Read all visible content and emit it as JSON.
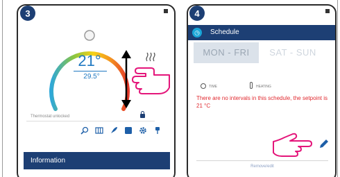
{
  "colors": {
    "accent": "#1d3f74",
    "link": "#1f78c1",
    "warning": "#e0282e",
    "arc_start": "#2fa8d8",
    "arc_end": "#e53a2a"
  },
  "screens": [
    {
      "step": "3",
      "temp_setpoint": "21°",
      "temp_current": "29.5°",
      "thermostat_status": "Thermostat unlocked",
      "heat_icon": "heating-waves-icon",
      "lock_icon": "lock-icon",
      "toolbar_icons": [
        "magnifier-icon",
        "grid-icon",
        "rocket-icon",
        "square-icon",
        "gear-icon",
        "pin-icon"
      ],
      "info_label": "Information"
    },
    {
      "step": "4",
      "header_title": "Schedule",
      "tabs": [
        "MON - FRI",
        "SAT - SUN"
      ],
      "legend_time": "TIME",
      "legend_heating": "HEATING",
      "warning_text": "There are no intervals in this schedule, the setpoint is 21 °C",
      "bottom_text": "Remove/edit",
      "edit_icon": "pencil-icon"
    }
  ]
}
